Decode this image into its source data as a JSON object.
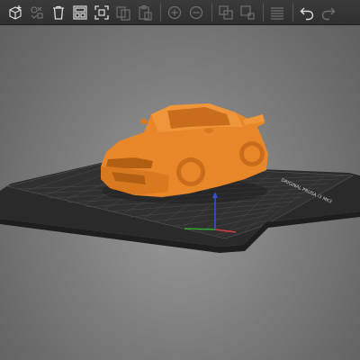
{
  "toolbar": {
    "buttons": [
      {
        "name": "add-object",
        "icon": "cube-plus-icon",
        "enabled": true
      },
      {
        "name": "add-shape",
        "icon": "shape-gallery-icon",
        "enabled": false
      },
      {
        "name": "delete",
        "icon": "trash-icon",
        "enabled": true
      },
      {
        "name": "arrange",
        "icon": "arrange-icon",
        "enabled": true
      },
      {
        "name": "select-all",
        "icon": "select-all-icon",
        "enabled": true
      },
      {
        "name": "copy",
        "icon": "copy-icon",
        "enabled": false
      },
      {
        "name": "paste",
        "icon": "paste-icon",
        "enabled": false
      },
      {
        "name": "add-instance",
        "icon": "plus-circle-icon",
        "enabled": false
      },
      {
        "name": "remove-instance",
        "icon": "minus-circle-icon",
        "enabled": false
      },
      {
        "name": "split-objects",
        "icon": "split-objects-icon",
        "enabled": false
      },
      {
        "name": "split-parts",
        "icon": "split-parts-icon",
        "enabled": false
      },
      {
        "name": "layers-editing",
        "icon": "layers-icon",
        "enabled": false
      },
      {
        "name": "undo",
        "icon": "undo-icon",
        "enabled": true
      },
      {
        "name": "redo",
        "icon": "redo-icon",
        "enabled": false
      }
    ]
  },
  "scene": {
    "model_color": "#e8862a",
    "model_shadow_color": "#b25f14",
    "bed_color": "#2c2c2c",
    "grid_color": "#4a4a4a",
    "bed_label": "ORIGINAL PRUSA i3 MK3",
    "axis_colors": {
      "x": "#d23c3c",
      "y": "#2fa83a",
      "z": "#2f4fd8"
    }
  }
}
